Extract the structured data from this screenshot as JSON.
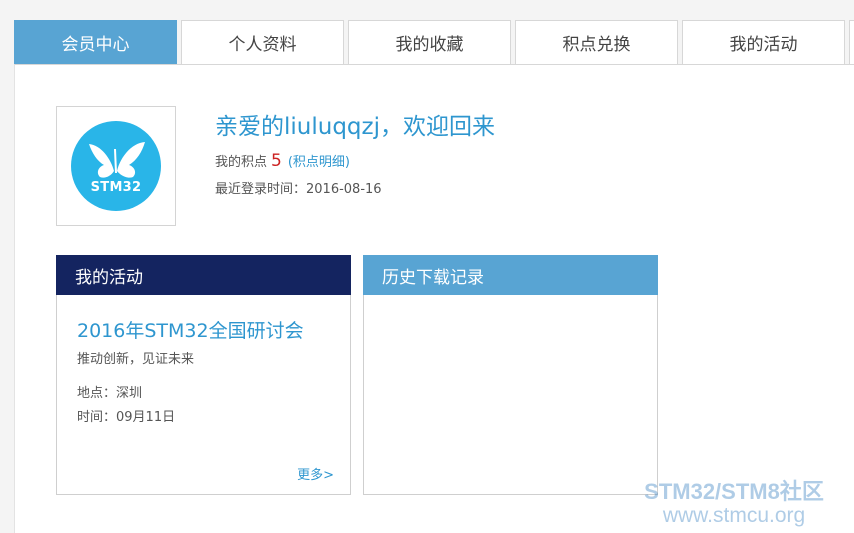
{
  "tabs": [
    {
      "label": "会员中心",
      "active": true
    },
    {
      "label": "个人资料",
      "active": false
    },
    {
      "label": "我的收藏",
      "active": false
    },
    {
      "label": "积点兑换",
      "active": false
    },
    {
      "label": "我的活动",
      "active": false
    }
  ],
  "profile": {
    "avatar_text": "STM32",
    "welcome": "亲爱的liuluqqzj，欢迎回来",
    "points_label": "我的积点",
    "points_value": "5",
    "points_link": "(积点明细)",
    "last_login_label": "最近登录时间：",
    "last_login_value": "2016-08-16"
  },
  "activity_card": {
    "header": "我的活动",
    "event_title": "2016年STM32全国研讨会",
    "event_subtitle": "推动创新，见证未来",
    "place": "地点：深圳",
    "time": "时间：09月11日",
    "more": "更多>"
  },
  "history_card": {
    "header": "历史下载记录"
  },
  "watermark": {
    "line1": "STM32/STM8社区",
    "line2": "www.stmcu.org"
  },
  "colors": {
    "accent_blue": "#58a4d3",
    "dark_navy": "#142460",
    "link_blue": "#2e96cf",
    "points_red": "#cc2222",
    "avatar_blue": "#29b5e8"
  },
  "icons": {
    "avatar_logo": "butterfly-icon"
  }
}
